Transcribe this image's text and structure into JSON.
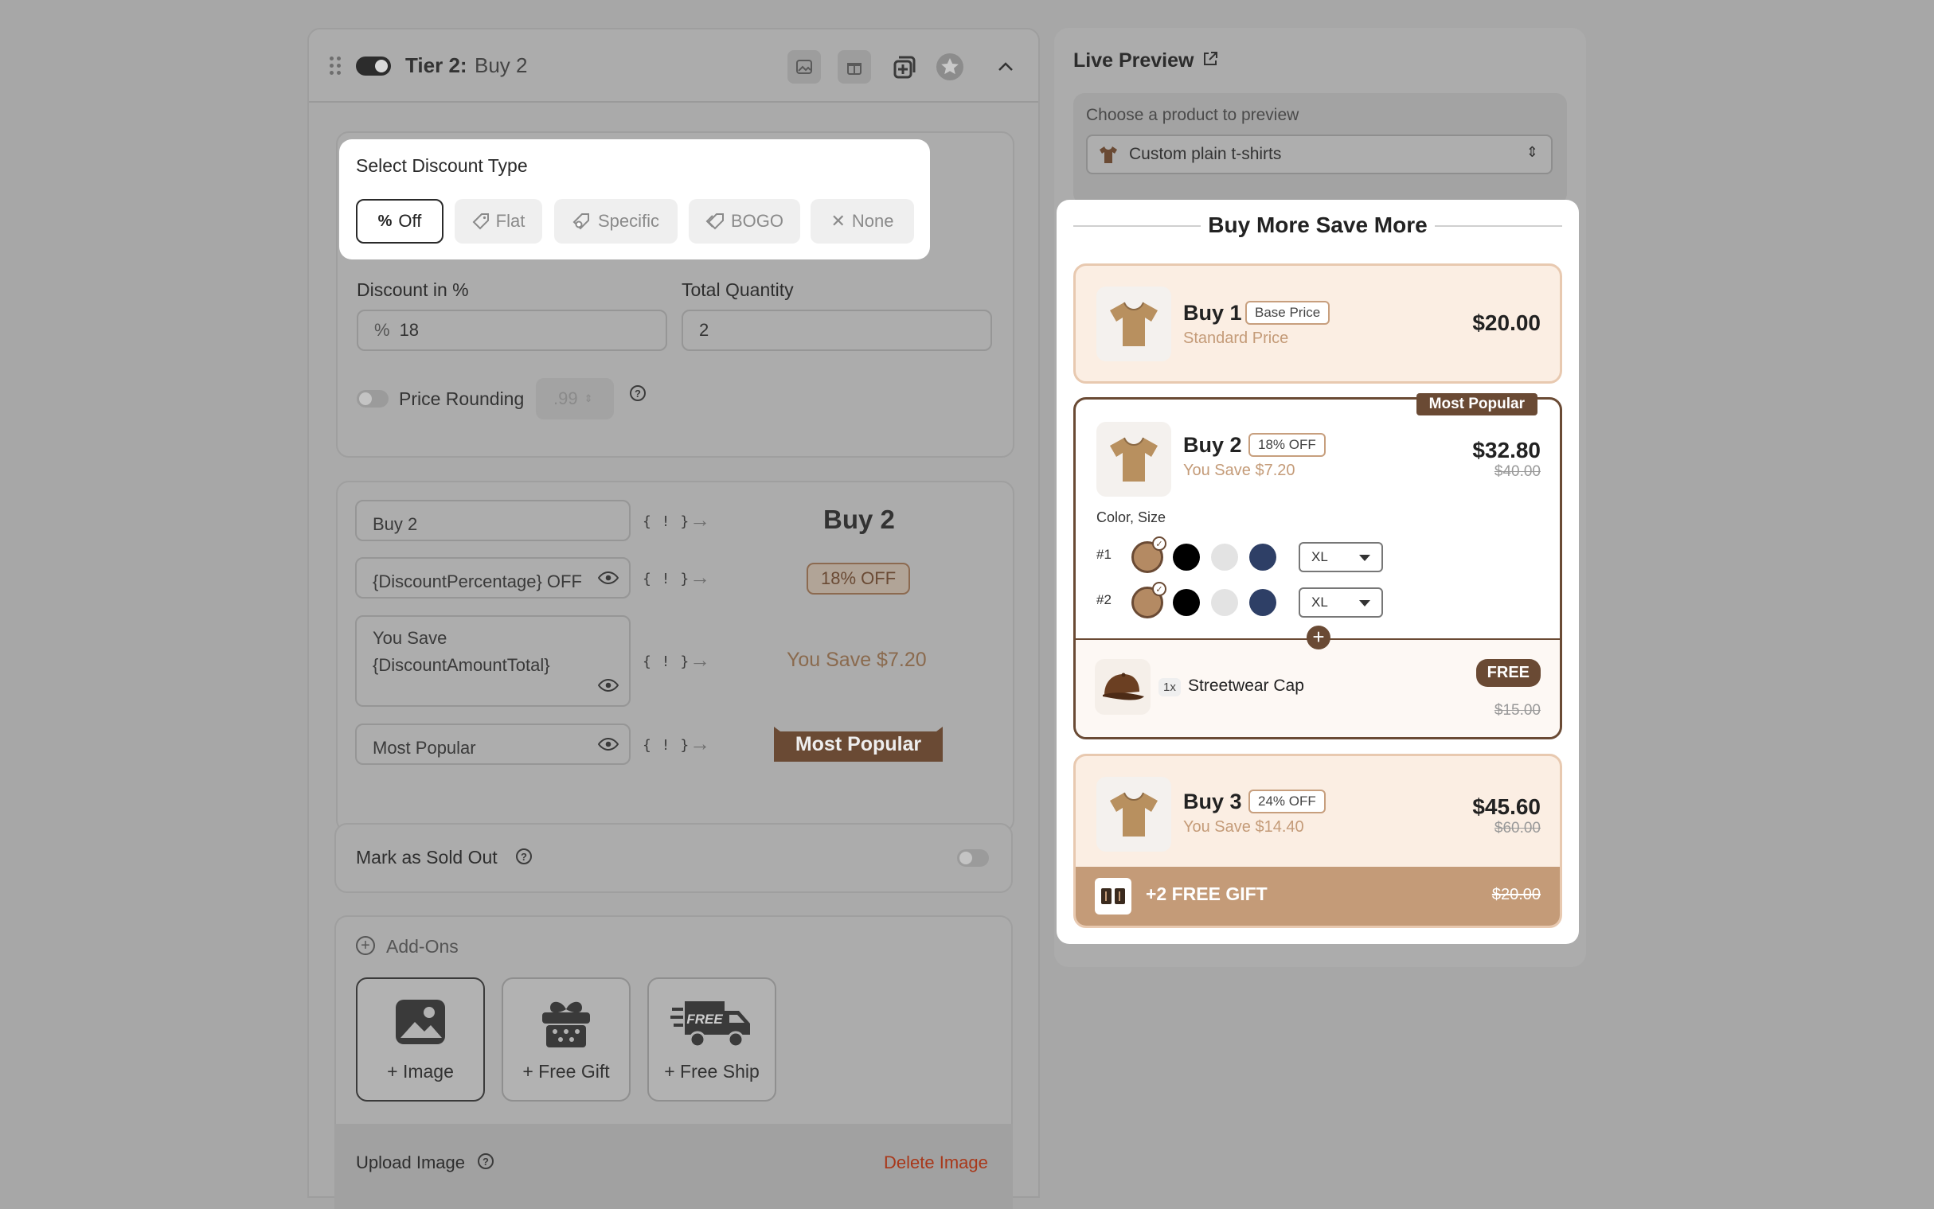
{
  "tier": {
    "title": "Tier 2:",
    "subtitle": "Buy 2",
    "icons": [
      "image-icon",
      "gift-icon",
      "duplicate-icon",
      "star-icon",
      "chevron-up-icon"
    ]
  },
  "discount_type": {
    "title": "Select Discount Type",
    "options": [
      {
        "label": "Off",
        "icon": "percent-icon",
        "active": true
      },
      {
        "label": "Flat",
        "icon": "tag-icon"
      },
      {
        "label": "Specific",
        "icon": "specific-tag-icon"
      },
      {
        "label": "BOGO",
        "icon": "double-tag-icon"
      },
      {
        "label": "None",
        "icon": "x-icon"
      }
    ]
  },
  "fields": {
    "discount_label": "Discount in %",
    "discount_prefix": "%",
    "discount_value": "18",
    "quantity_label": "Total Quantity",
    "quantity_value": "2",
    "rounding_label": "Price Rounding",
    "rounding_value": ".99"
  },
  "text_rows": [
    {
      "input": "Buy 2",
      "var": "{ ! }",
      "preview": "Buy 2"
    },
    {
      "input": "{DiscountPercentage} OFF",
      "var": "{ ! }",
      "preview": "18% OFF"
    },
    {
      "input": "You Save {DiscountAmountTotal}",
      "var": "{ ! }",
      "preview": "You Save $7.20"
    },
    {
      "input": "Most Popular",
      "var": "{ ! }",
      "preview": "Most Popular"
    }
  ],
  "sold_out": {
    "label": "Mark as Sold Out"
  },
  "addons": {
    "title": "Add-Ons",
    "tiles": [
      {
        "label": "+ Image",
        "icon": "image-icon"
      },
      {
        "label": "+ Free Gift",
        "icon": "gift-box-icon"
      },
      {
        "label": "+ Free Ship",
        "icon": "free-shipping-truck-icon",
        "badge": "FREE"
      }
    ],
    "upload_label": "Upload Image",
    "delete_label": "Delete Image"
  },
  "preview": {
    "title": "Live Preview",
    "chooser_label": "Choose a product to preview",
    "selected_product": "Custom plain t-shirts",
    "widget_title": "Buy More Save More",
    "tiers": [
      {
        "name": "Buy 1",
        "badge": "Base Price",
        "sub": "Standard Price",
        "price": "$20.00"
      },
      {
        "name": "Buy 2",
        "badge": "18% OFF",
        "sub": "You Save $7.20",
        "price": "$32.80",
        "old_price": "$40.00",
        "ribbon": "Most Popular",
        "options_label": "Color, Size",
        "variants": [
          {
            "num": "#1",
            "size": "XL"
          },
          {
            "num": "#2",
            "size": "XL"
          }
        ],
        "swatch_colors": [
          "#b48a63",
          "#000000",
          "#e3e3e3",
          "#2e3f66"
        ],
        "gift": {
          "qty": "1x",
          "name": "Streetwear Cap",
          "pill": "FREE",
          "old_price": "$15.00"
        }
      },
      {
        "name": "Buy 3",
        "badge": "24% OFF",
        "sub": "You Save $14.40",
        "price": "$45.60",
        "old_price": "$60.00",
        "gift_bar": {
          "label": "+2 FREE GIFT",
          "old_price": "$20.00"
        }
      }
    ]
  },
  "colors": {
    "accent": "#6a4a34",
    "tan": "#c49b78",
    "cream": "#fbeee3",
    "danger": "#c0401c"
  }
}
